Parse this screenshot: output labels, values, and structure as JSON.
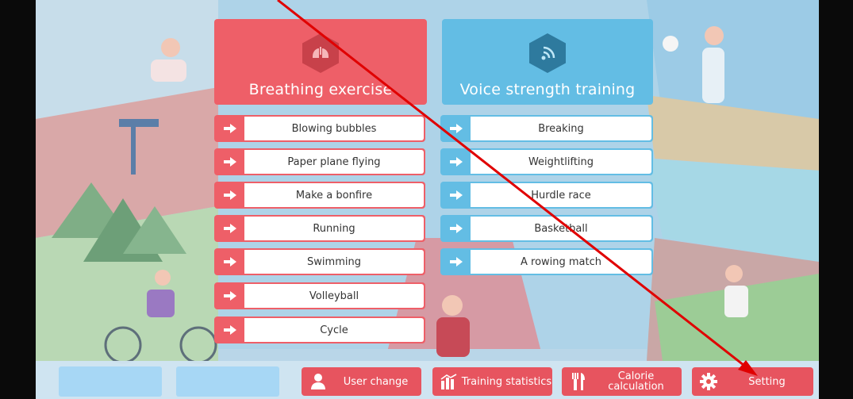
{
  "breathing": {
    "title": "Breathing exercise",
    "items": [
      "Blowing bubbles",
      "Paper plane flying",
      "Make a bonfire",
      "Running",
      "Swimming",
      "Volleyball",
      "Cycle"
    ]
  },
  "voice": {
    "title": "Voice strength training",
    "items": [
      "Breaking",
      "Weightlifting",
      "Hurdle race",
      "Basketball",
      "A rowing match"
    ]
  },
  "bottom": {
    "user_change": "User change",
    "training_statistics": "Training statistics",
    "calorie_calculation": "Calorie calculation",
    "setting": "Setting"
  },
  "colors": {
    "red": "#ee5f68",
    "blue": "#63bde4",
    "annotation": "#e00000"
  },
  "icons": [
    "lungs-icon",
    "sound-wave-icon",
    "arrow-right-icon",
    "user-icon",
    "bar-chart-icon",
    "fork-knife-icon",
    "gear-icon"
  ]
}
